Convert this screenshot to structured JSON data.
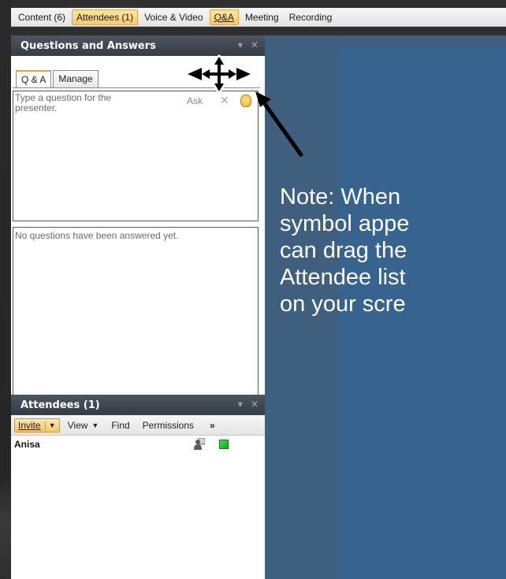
{
  "top_tabs": [
    {
      "label": "Content (6)",
      "highlighted": false
    },
    {
      "label": "Attendees (1)",
      "highlighted": true
    },
    {
      "label": "Voice & Video",
      "highlighted": false
    },
    {
      "label": "Q&A",
      "highlighted": true
    },
    {
      "label": "Meeting",
      "highlighted": false
    },
    {
      "label": "Recording",
      "highlighted": false
    }
  ],
  "qa_panel": {
    "title": "Questions and Answers",
    "tabs": [
      "Q & A",
      "Manage"
    ],
    "question_placeholder": "Type a question for the presenter.",
    "ask_label": "Ask",
    "answers_empty": "No questions have been answered yet."
  },
  "attendees_panel": {
    "title": "Attendees (1)",
    "toolbar": {
      "invite": "Invite",
      "view": "View",
      "find": "Find",
      "permissions": "Permissions",
      "more": "»"
    },
    "attendees": [
      {
        "name": "Anisa",
        "status_color": "#22c52e"
      }
    ]
  },
  "note": {
    "lines": [
      "Note: When",
      "symbol appe",
      "can drag the",
      "Attendee list",
      "on your scre"
    ]
  },
  "colors": {
    "accent_orange": "#f8c96a",
    "panel_header": "#3f4850",
    "slide_blue": "#36648f",
    "stage_bg": "#3f5f7f"
  },
  "icons": [
    "move-cursor-icon",
    "pointer-arrow-icon",
    "raise-hand-icon",
    "clear-x-icon",
    "person-icon",
    "status-square-icon",
    "close-icon",
    "chevron-down-icon"
  ]
}
